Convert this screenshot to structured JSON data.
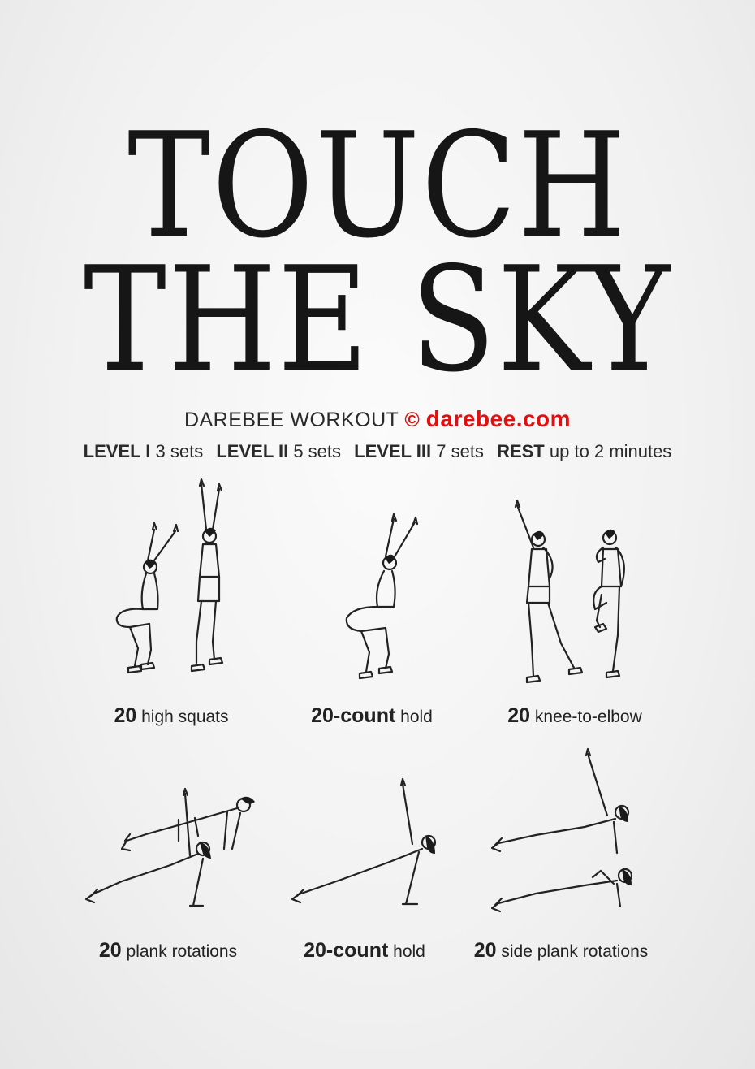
{
  "title": {
    "line1": "TOUCH",
    "line2": "THE SKY"
  },
  "subtitle": {
    "brand": "DAREBEE WORKOUT",
    "copyright": "©",
    "site": "darebee.com"
  },
  "levels": [
    {
      "label": "LEVEL I",
      "value": "3 sets"
    },
    {
      "label": "LEVEL II",
      "value": "5 sets"
    },
    {
      "label": "LEVEL III",
      "value": "7 sets"
    },
    {
      "label": "REST",
      "value": "up to 2 minutes"
    }
  ],
  "exercises": [
    {
      "count": "20",
      "name": "high squats",
      "icon": "high-squats-figure"
    },
    {
      "count": "20-count",
      "name": "hold",
      "icon": "squat-hold-figure"
    },
    {
      "count": "20",
      "name": "knee-to-elbow",
      "icon": "knee-to-elbow-figure"
    },
    {
      "count": "20",
      "name": "plank rotations",
      "icon": "plank-rotations-figure"
    },
    {
      "count": "20-count",
      "name": "hold",
      "icon": "side-plank-hold-figure"
    },
    {
      "count": "20",
      "name": "side plank rotations",
      "icon": "side-plank-rotations-figure"
    }
  ]
}
